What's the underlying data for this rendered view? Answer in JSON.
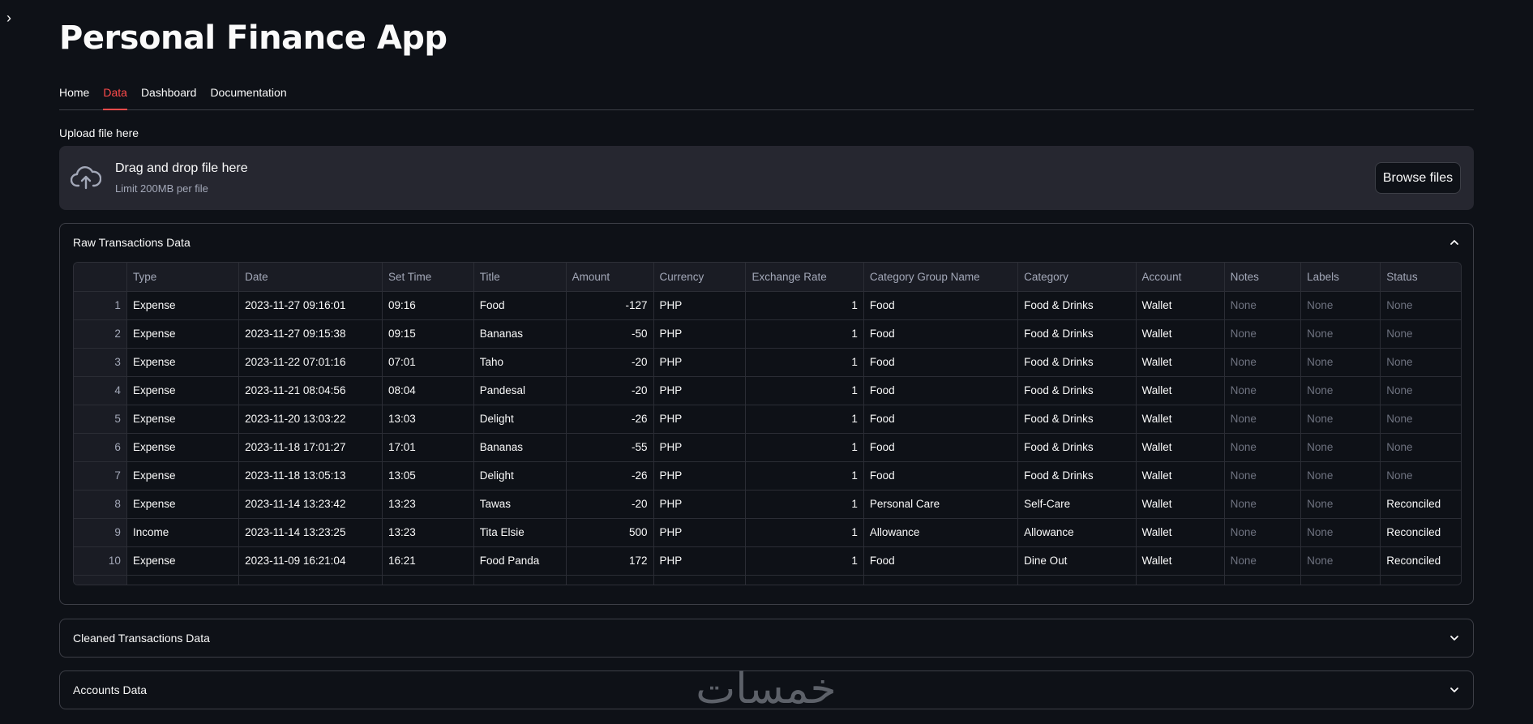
{
  "app": {
    "title": "Personal Finance App"
  },
  "tabs": [
    {
      "label": "Home"
    },
    {
      "label": "Data",
      "active": true
    },
    {
      "label": "Dashboard"
    },
    {
      "label": "Documentation"
    }
  ],
  "upload": {
    "label": "Upload file here",
    "drop_title": "Drag and drop file here",
    "limit": "Limit 200MB per file",
    "browse_label": "Browse files",
    "icon": "cloud-upload-icon"
  },
  "expanders": {
    "raw": {
      "title": "Raw Transactions Data",
      "expanded": true
    },
    "cleaned": {
      "title": "Cleaned Transactions Data",
      "expanded": false
    },
    "accounts": {
      "title": "Accounts Data",
      "expanded": false
    }
  },
  "table": {
    "columns": [
      "",
      "Type",
      "Date",
      "Set Time",
      "Title",
      "Amount",
      "Currency",
      "Exchange Rate",
      "Category Group Name",
      "Category",
      "Account",
      "Notes",
      "Labels",
      "Status"
    ],
    "rows": [
      [
        "1",
        "Expense",
        "2023-11-27 09:16:01",
        "09:16",
        "Food",
        "-127",
        "PHP",
        "1",
        "Food",
        "Food & Drinks",
        "Wallet",
        "None",
        "None",
        "None"
      ],
      [
        "2",
        "Expense",
        "2023-11-27 09:15:38",
        "09:15",
        "Bananas",
        "-50",
        "PHP",
        "1",
        "Food",
        "Food & Drinks",
        "Wallet",
        "None",
        "None",
        "None"
      ],
      [
        "3",
        "Expense",
        "2023-11-22 07:01:16",
        "07:01",
        "Taho",
        "-20",
        "PHP",
        "1",
        "Food",
        "Food & Drinks",
        "Wallet",
        "None",
        "None",
        "None"
      ],
      [
        "4",
        "Expense",
        "2023-11-21 08:04:56",
        "08:04",
        "Pandesal",
        "-20",
        "PHP",
        "1",
        "Food",
        "Food & Drinks",
        "Wallet",
        "None",
        "None",
        "None"
      ],
      [
        "5",
        "Expense",
        "2023-11-20 13:03:22",
        "13:03",
        "Delight",
        "-26",
        "PHP",
        "1",
        "Food",
        "Food & Drinks",
        "Wallet",
        "None",
        "None",
        "None"
      ],
      [
        "6",
        "Expense",
        "2023-11-18 17:01:27",
        "17:01",
        "Bananas",
        "-55",
        "PHP",
        "1",
        "Food",
        "Food & Drinks",
        "Wallet",
        "None",
        "None",
        "None"
      ],
      [
        "7",
        "Expense",
        "2023-11-18 13:05:13",
        "13:05",
        "Delight",
        "-26",
        "PHP",
        "1",
        "Food",
        "Food & Drinks",
        "Wallet",
        "None",
        "None",
        "None"
      ],
      [
        "8",
        "Expense",
        "2023-11-14 13:23:42",
        "13:23",
        "Tawas",
        "-20",
        "PHP",
        "1",
        "Personal Care",
        "Self-Care",
        "Wallet",
        "None",
        "None",
        "Reconciled"
      ],
      [
        "9",
        "Income",
        "2023-11-14 13:23:25",
        "13:23",
        "Tita Elsie",
        "500",
        "PHP",
        "1",
        "Allowance",
        "Allowance",
        "Wallet",
        "None",
        "None",
        "Reconciled"
      ],
      [
        "10",
        "Expense",
        "2023-11-09 16:21:04",
        "16:21",
        "Food Panda",
        "172",
        "PHP",
        "1",
        "Food",
        "Dine Out",
        "Wallet",
        "None",
        "None",
        "Reconciled"
      ]
    ]
  },
  "watermark": {
    "text": "خمسات"
  },
  "colors": {
    "accent": "#ff4b4b",
    "background": "#0e1117",
    "panel": "#262730"
  }
}
